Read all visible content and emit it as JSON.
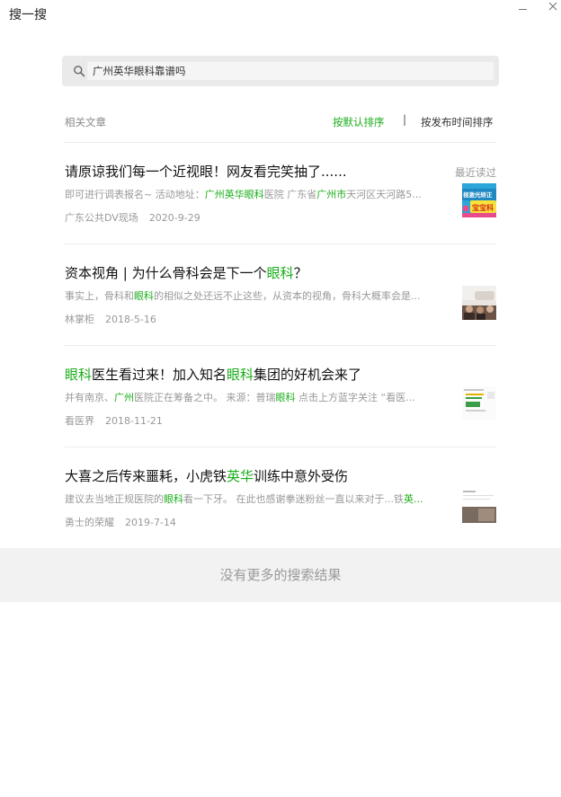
{
  "window": {
    "title": "搜一搜",
    "minimize_icon": "minimize-icon",
    "close_icon": "close-icon"
  },
  "search": {
    "query": "广州英华眼科靠谱吗",
    "icon": "search-icon"
  },
  "section": {
    "label": "相关文章",
    "sort_default": "按默认排序",
    "sort_divider": "|",
    "sort_time": "按发布时间排序",
    "accent_color": "#1aad19"
  },
  "results": [
    {
      "title": [
        {
          "t": "请原谅我们每一个近视眼！网友看完笑抽了......",
          "h": false
        }
      ],
      "snippet": [
        {
          "t": "即可进行调表报名~ 活动地址：",
          "h": false
        },
        {
          "t": "广州英华眼科",
          "h": true
        },
        {
          "t": "医院 广东省",
          "h": false
        },
        {
          "t": "广州市",
          "h": true
        },
        {
          "t": "天河区天河路5...",
          "h": false
        }
      ],
      "source": "广东公共DV现场",
      "date": "2020-9-29",
      "badge": "最近读过"
    },
    {
      "title": [
        {
          "t": "资本视角 | 为什么骨科会是下一个",
          "h": false
        },
        {
          "t": "眼科",
          "h": true
        },
        {
          "t": "？",
          "h": false
        }
      ],
      "snippet": [
        {
          "t": "事实上，骨科和",
          "h": false
        },
        {
          "t": "眼科",
          "h": true
        },
        {
          "t": "的相似之处还远不止这些，从资本的视角，骨科大概率会是...",
          "h": false
        }
      ],
      "source": "林掌柜",
      "date": "2018-5-16",
      "badge": ""
    },
    {
      "title": [
        {
          "t": "眼科",
          "h": true
        },
        {
          "t": "医生看过来！加入知名",
          "h": false
        },
        {
          "t": "眼科",
          "h": true
        },
        {
          "t": "集团的好机会来了",
          "h": false
        }
      ],
      "snippet": [
        {
          "t": "并有南京、",
          "h": false
        },
        {
          "t": "广州",
          "h": true
        },
        {
          "t": "医院正在筹备之中。 来源：普瑞",
          "h": false
        },
        {
          "t": "眼科",
          "h": true
        },
        {
          "t": " 点击上方蓝字关注 “看医...",
          "h": false
        }
      ],
      "source": "看医界",
      "date": "2018-11-21",
      "badge": ""
    },
    {
      "title": [
        {
          "t": "大喜之后传来噩耗，小虎铁",
          "h": false
        },
        {
          "t": "英华",
          "h": true
        },
        {
          "t": "训练中意外受伤",
          "h": false
        }
      ],
      "snippet": [
        {
          "t": "建议去当地正规医院的",
          "h": false
        },
        {
          "t": "眼科",
          "h": true
        },
        {
          "t": "看一下牙。 在此也感谢拳迷粉丝一直以来对于...铁",
          "h": false
        },
        {
          "t": "英...",
          "h": true
        }
      ],
      "source": "勇士的荣耀",
      "date": "2019-7-14",
      "badge": ""
    }
  ],
  "thumb_texts": [
    "视激光矫正",
    "宝宝科"
  ],
  "footer": {
    "text": "没有更多的搜索结果"
  }
}
